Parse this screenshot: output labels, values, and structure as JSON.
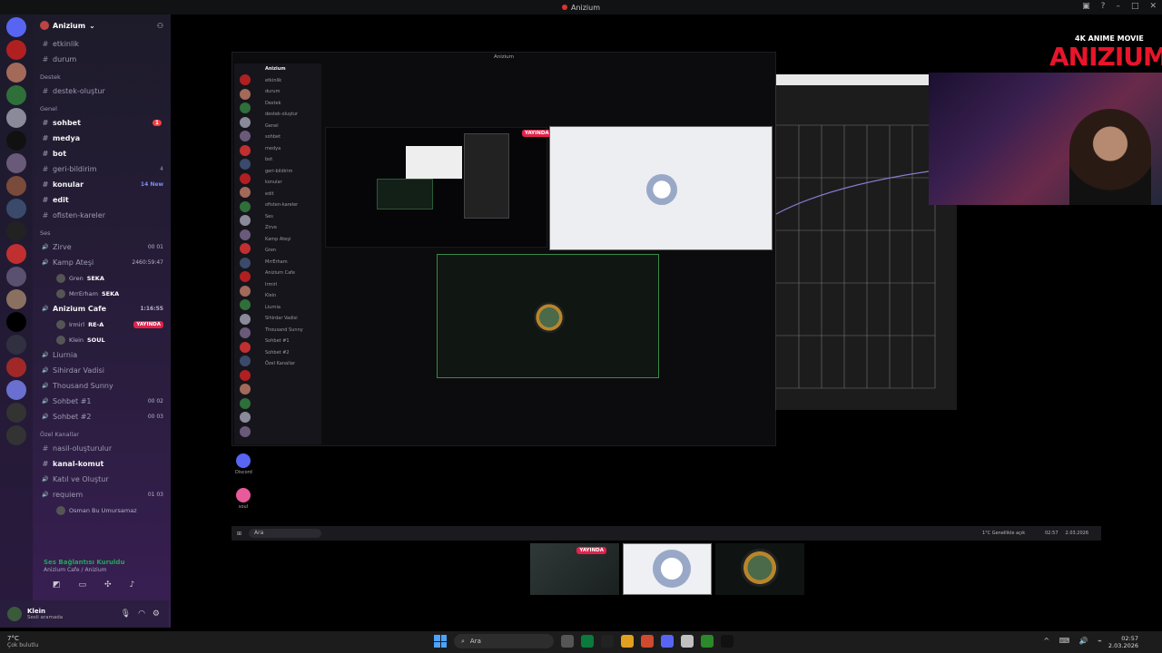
{
  "window": {
    "title": "Anizium"
  },
  "server": {
    "name": "Anizium"
  },
  "channels": [
    {
      "name": "etkinlik",
      "type": "text",
      "bold": false
    },
    {
      "name": "durum",
      "type": "text",
      "bold": false
    },
    {
      "category": "Destek"
    },
    {
      "name": "destek-oluştur",
      "type": "text",
      "bold": false
    },
    {
      "category": "Genel"
    },
    {
      "name": "sohbet",
      "type": "text",
      "bold": true,
      "badge": "1"
    },
    {
      "name": "medya",
      "type": "text",
      "bold": true
    },
    {
      "name": "bot",
      "type": "text",
      "bold": true
    },
    {
      "name": "geri-bildirim",
      "type": "text",
      "bold": false,
      "count": "4"
    },
    {
      "name": "konular",
      "type": "text",
      "bold": true,
      "newtag": "14 New"
    },
    {
      "name": "edit",
      "type": "text",
      "bold": true
    },
    {
      "name": "ofisten-kareler",
      "type": "text",
      "bold": false
    },
    {
      "category": "Ses"
    },
    {
      "name": "Zirve",
      "type": "voice",
      "bold": false,
      "timer": "00 01"
    },
    {
      "name": "Kamp Ateşi",
      "type": "voice",
      "bold": false,
      "timer": "2460:59:47"
    },
    {
      "user": "Gren",
      "tag": "SEKA"
    },
    {
      "user": "MrrErham",
      "tag": "SEKA"
    },
    {
      "name": "Anizium Cafe",
      "type": "voice",
      "bold": true,
      "timer": "1:16:55"
    },
    {
      "user": "Irmirl",
      "tag": "RE-A",
      "live": "YAYINDA"
    },
    {
      "user": "Klein",
      "tag": "SOUL"
    },
    {
      "name": "Liurnia",
      "type": "voice",
      "bold": false
    },
    {
      "name": "Sihirdar Vadisi",
      "type": "voice",
      "bold": false
    },
    {
      "name": "Thousand Sunny",
      "type": "voice",
      "bold": false
    },
    {
      "name": "Sohbet #1",
      "type": "voice",
      "bold": false,
      "timer": "00 02"
    },
    {
      "name": "Sohbet #2",
      "type": "voice",
      "bold": false,
      "timer": "00 03"
    },
    {
      "category": "Özel Kanallar"
    },
    {
      "name": "nasil-oluşturulur",
      "type": "text",
      "bold": false
    },
    {
      "name": "kanal-komut",
      "type": "text",
      "bold": true
    },
    {
      "name": "Katıl ve Oluştur",
      "type": "voice",
      "bold": false
    },
    {
      "name": "requiem",
      "type": "voice",
      "bold": false,
      "timer": "01 03"
    },
    {
      "user": "Osman Bu Umursamaz"
    }
  ],
  "voice_panel": {
    "status": "Ses Bağlantısı Kuruldu",
    "location": "Anizium Cafe / Anizium"
  },
  "user_panel": {
    "name": "Klein",
    "status": "Sesli aramada"
  },
  "inner": {
    "title": "Anizium",
    "live": "YAYINDA",
    "discord_label": "Discord",
    "soul_label": "soul"
  },
  "inner_taskbar": {
    "search": "Ara",
    "weather": "1°C Genellikle açık",
    "time": "02:57",
    "date": "2.03.2026"
  },
  "thumb_live": "YAYINDA",
  "logo": {
    "small": "4K ANIME MOVIE",
    "big": "ANIZIUM"
  },
  "taskbar": {
    "weather_temp": "7°C",
    "weather_desc": "Çok bulutlu",
    "search": "Ara",
    "time": "02:57",
    "date": "2.03.2026"
  },
  "colors": {
    "live": "#e0234b",
    "accent": "#7b8cff",
    "online": "#23a55a"
  }
}
